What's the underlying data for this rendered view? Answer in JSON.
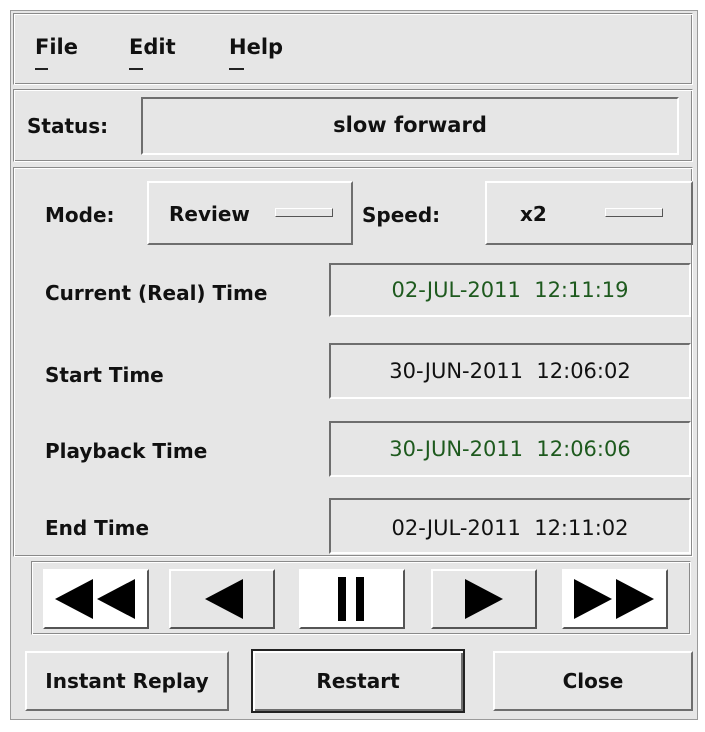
{
  "menu": {
    "file": "File",
    "edit": "Edit",
    "help": "Help"
  },
  "status": {
    "label": "Status:",
    "value": "slow forward"
  },
  "mode": {
    "label": "Mode:",
    "value": "Review"
  },
  "speed": {
    "label": "Speed:",
    "value": "x2"
  },
  "times": {
    "current": {
      "label": "Current (Real) Time",
      "value": "02-JUL-2011  12:11:19"
    },
    "start": {
      "label": "Start Time",
      "value": "30-JUN-2011  12:06:02"
    },
    "playback": {
      "label": "Playback Time",
      "value": "30-JUN-2011  12:06:06"
    },
    "end": {
      "label": "End Time",
      "value": "02-JUL-2011  12:11:02"
    }
  },
  "transport_icons": [
    "fast-rewind-icon",
    "rewind-icon",
    "pause-icon",
    "play-icon",
    "fast-forward-icon"
  ],
  "buttons": {
    "instant_replay": "Instant Replay",
    "restart": "Restart",
    "close": "Close"
  },
  "colors": {
    "live_time": "#1e5a1e",
    "static_time": "#111111",
    "background": "#e6e6e6"
  }
}
